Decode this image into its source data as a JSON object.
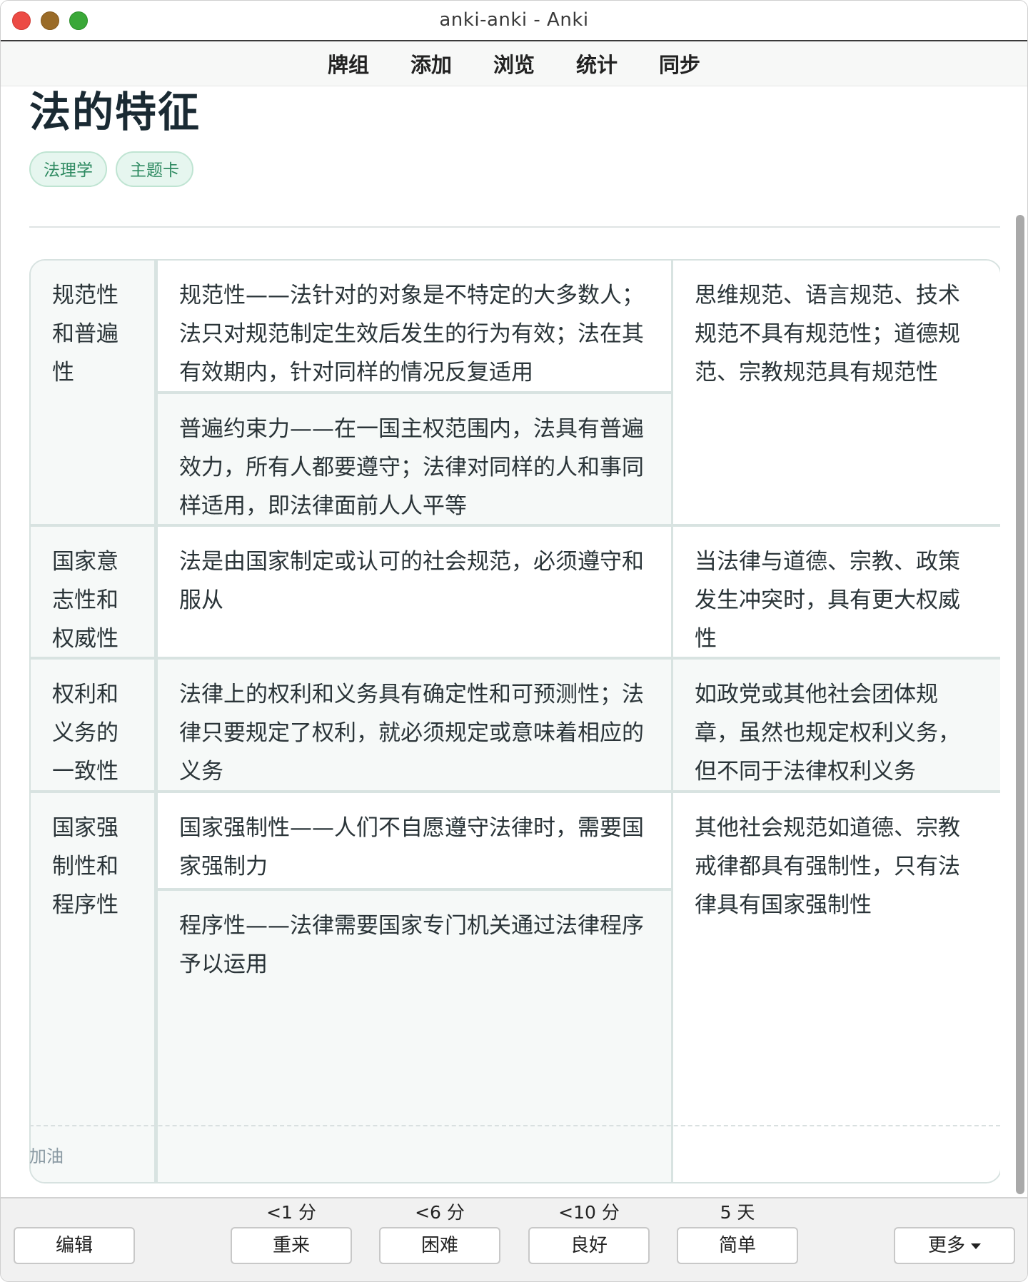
{
  "window": {
    "title": "anki-anki - Anki"
  },
  "nav": {
    "decks": "牌组",
    "add": "添加",
    "browse": "浏览",
    "stats": "统计",
    "sync": "同步"
  },
  "card": {
    "title": "法的特征",
    "tags": [
      "法理学",
      "主题卡"
    ],
    "rows": [
      {
        "feature": "规范性和普遍性",
        "details": [
          "规范性——法针对的对象是不特定的大多数人；法只对规范制定生效后发生的行为有效；法在其有效期内，针对同样的情况反复适用",
          "普遍约束力——在一国主权范围内，法具有普遍效力，所有人都要遵守；法律对同样的人和事同样适用，即法律面前人人平等"
        ],
        "note": "思维规范、语言规范、技术规范不具有规范性；道德规范、宗教规范具有规范性"
      },
      {
        "feature": "国家意志性和权威性",
        "details": [
          "法是由国家制定或认可的社会规范，必须遵守和服从"
        ],
        "note": "当法律与道德、宗教、政策发生冲突时，具有更大权威性"
      },
      {
        "feature": "权利和义务的一致性",
        "details": [
          "法律上的权利和义务具有确定性和可预测性；法律只要规定了权利，就必须规定或意味着相应的义务"
        ],
        "note": "如政党或其他社会团体规章，虽然也规定权利义务，但不同于法律权利义务"
      },
      {
        "feature": "国家强制性和程序性",
        "details": [
          "国家强制性——人们不自愿遵守法律时，需要国家强制力",
          "程序性——法律需要国家专门机关通过法律程序予以运用"
        ],
        "note": "其他社会规范如道德、宗教戒律都具有强制性，只有法律具有国家强制性"
      }
    ],
    "footnote": "加油"
  },
  "bottom": {
    "edit": "编辑",
    "again": {
      "label": "重来",
      "due": "<1 分"
    },
    "hard": {
      "label": "困难",
      "due": "<6 分"
    },
    "good": {
      "label": "良好",
      "due": "<10 分"
    },
    "easy": {
      "label": "简单",
      "due": "5 天"
    },
    "more": "更多"
  }
}
